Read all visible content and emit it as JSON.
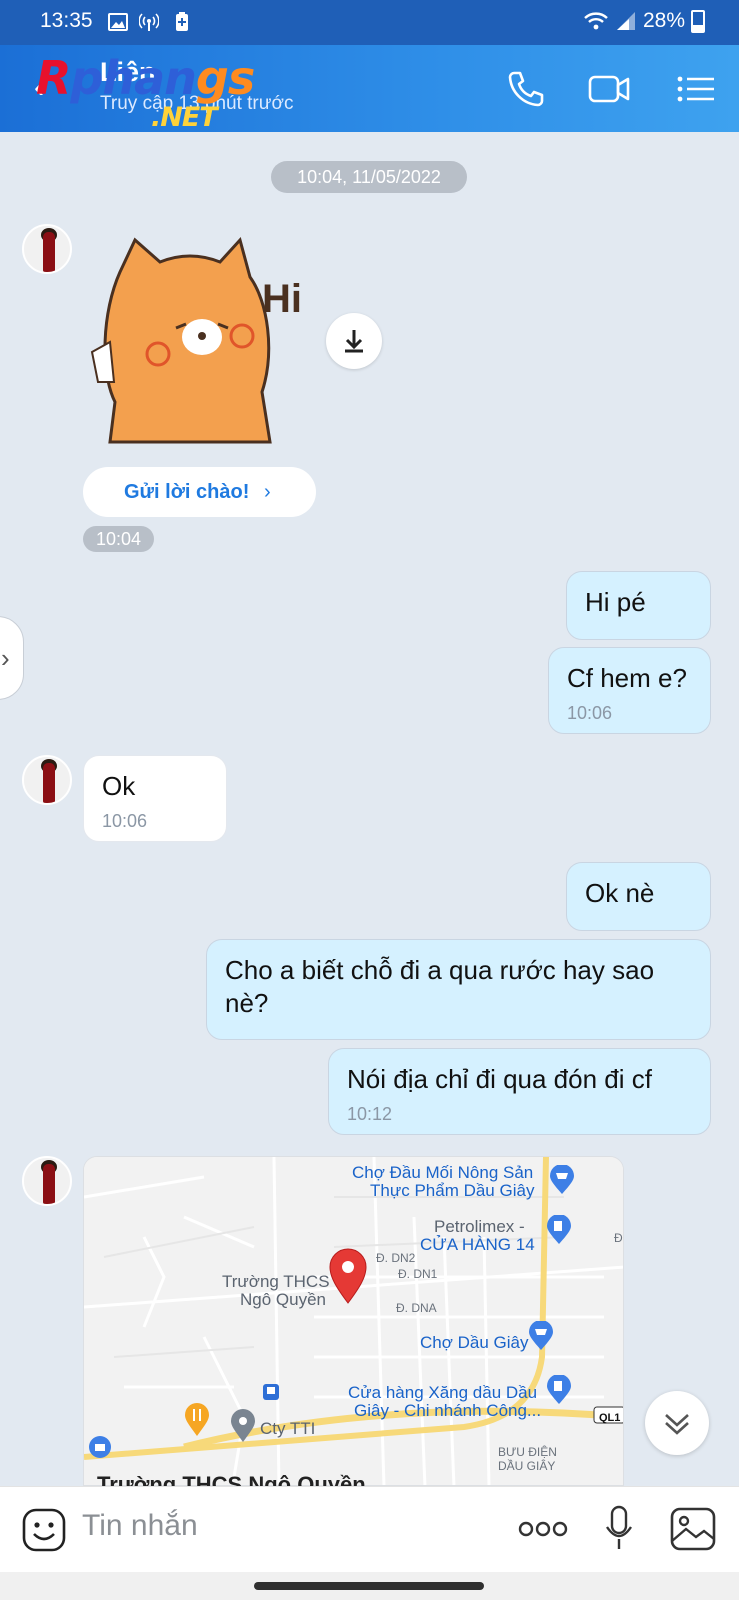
{
  "status_bar": {
    "time": "13:35",
    "battery": "28%",
    "icons": [
      "gallery-icon",
      "hotspot-icon",
      "battery-saver-icon",
      "wifi-icon",
      "signal-icon",
      "battery-icon"
    ]
  },
  "header": {
    "back_icon": "back-arrow-icon",
    "contact_name": "Liên",
    "last_seen": "Truy cập 13 phút trước",
    "watermark_part1": "R",
    "watermark_part2": "phan",
    "watermark_part3": "gs",
    "watermark_net": ".NET",
    "actions": [
      "phone-icon",
      "video-call-icon",
      "menu-icon"
    ]
  },
  "conversation": {
    "date_separator": "10:04, 11/05/2022",
    "sticker_text": "Hi",
    "greet_button": "Gửi lời chào!",
    "greet_chevron": "›",
    "greet_time": "10:04",
    "side_handle": "›",
    "messages": [
      {
        "from": "me",
        "text": "Hi pé",
        "time": ""
      },
      {
        "from": "me",
        "text": "Cf hem e?",
        "time": "10:06"
      },
      {
        "from": "them",
        "text": "Ok",
        "time": "10:06"
      },
      {
        "from": "me",
        "text": "Ok nè",
        "time": ""
      },
      {
        "from": "me",
        "text": "Cho a biết chỗ đi a qua rước hay sao nè?",
        "time": ""
      },
      {
        "from": "me",
        "text": "Nói địa chỉ đi qua đón đi cf",
        "time": "10:12"
      }
    ],
    "map": {
      "labels": {
        "market1_line1": "Chợ Đầu Mối Nông Sản",
        "market1_line2": "Thực Phẩm Dầu Giây",
        "petro_line1": "Petrolimex -",
        "petro_line2": "CỬA HÀNG 14",
        "school_line1": "Trường THCS",
        "school_line2": "Ngô Quyền",
        "dn2": "Đ. DN2",
        "dn1": "Đ. DN1",
        "dna": "Đ. DNA",
        "market2": "Chợ Dầu Giây",
        "gas_line1": "Cửa hàng Xăng dầu Dầu",
        "gas_line2": "Giây - Chi nhánh Công...",
        "cty": "Cty TTI",
        "post_line1": "BƯU ĐIỆN",
        "post_line2": "DẦU GIÂY",
        "road": "QL1",
        "edge": "Đ"
      },
      "caption": "Trường THCS Ngô Quyền"
    }
  },
  "input_bar": {
    "placeholder": "Tin nhắn",
    "icons": [
      "emoji-icon",
      "more-options-icon",
      "microphone-icon",
      "gallery-icon"
    ]
  }
}
